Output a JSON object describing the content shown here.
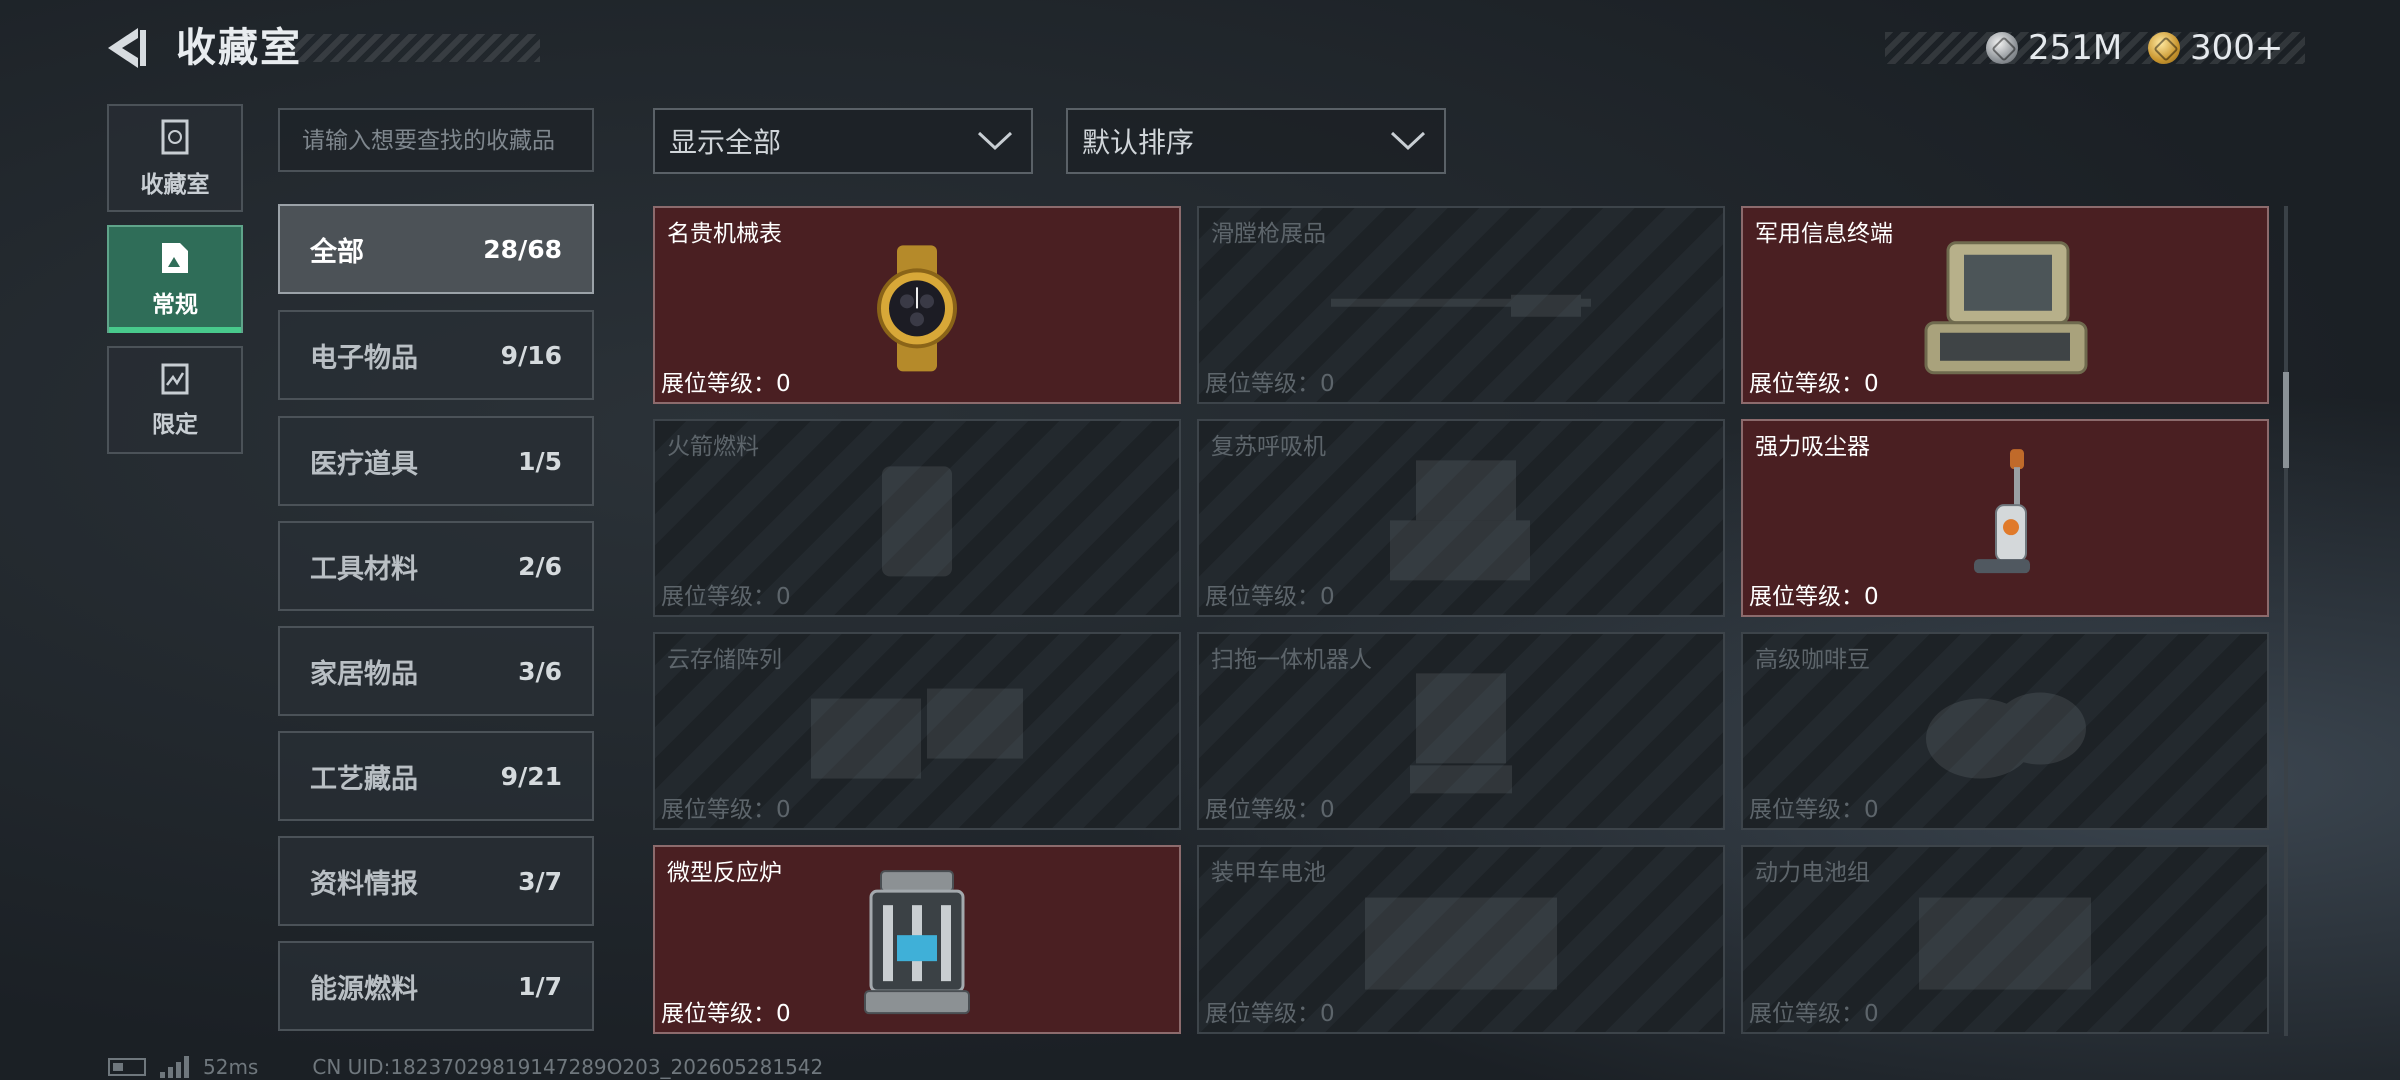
{
  "header": {
    "title": "收藏室"
  },
  "currency": {
    "silver": "251M",
    "gold": "300+"
  },
  "rail": [
    {
      "label": "收藏室",
      "icon": "collection-icon",
      "active": false
    },
    {
      "label": "常规",
      "icon": "regular-icon",
      "active": true
    },
    {
      "label": "限定",
      "icon": "limited-icon",
      "active": false
    }
  ],
  "search": {
    "placeholder": "请输入想要查找的收藏品"
  },
  "categories": [
    {
      "name": "全部",
      "count": "28/68",
      "active": true
    },
    {
      "name": "电子物品",
      "count": "9/16"
    },
    {
      "name": "医疗道具",
      "count": "1/5"
    },
    {
      "name": "工具材料",
      "count": "2/6"
    },
    {
      "name": "家居物品",
      "count": "3/6"
    },
    {
      "name": "工艺藏品",
      "count": "9/21"
    },
    {
      "name": "资料情报",
      "count": "3/7"
    },
    {
      "name": "能源燃料",
      "count": "1/7"
    }
  ],
  "filters": {
    "show": "显示全部",
    "sort": "默认排序"
  },
  "level_label": "展位等级：",
  "items": [
    {
      "name": "名贵机械表",
      "level": "0",
      "owned": true,
      "icon": "watch-icon"
    },
    {
      "name": "滑膛枪展品",
      "level": "0",
      "owned": false,
      "icon": "musket-icon"
    },
    {
      "name": "军用信息终端",
      "level": "0",
      "owned": true,
      "icon": "military-terminal-icon"
    },
    {
      "name": "火箭燃料",
      "level": "0",
      "owned": false,
      "icon": "rocket-fuel-icon"
    },
    {
      "name": "复苏呼吸机",
      "level": "0",
      "owned": false,
      "icon": "ventilator-icon"
    },
    {
      "name": "强力吸尘器",
      "level": "0",
      "owned": true,
      "icon": "vacuum-cleaner-icon"
    },
    {
      "name": "云存储阵列",
      "level": "0",
      "owned": false,
      "icon": "storage-array-icon"
    },
    {
      "name": "扫拖一体机器人",
      "level": "0",
      "owned": false,
      "icon": "robot-vacuum-icon"
    },
    {
      "name": "高级咖啡豆",
      "level": "0",
      "owned": false,
      "icon": "coffee-beans-icon"
    },
    {
      "name": "微型反应炉",
      "level": "0",
      "owned": true,
      "icon": "micro-reactor-icon"
    },
    {
      "name": "装甲车电池",
      "level": "0",
      "owned": false,
      "icon": "armored-battery-icon"
    },
    {
      "name": "动力电池组",
      "level": "0",
      "owned": false,
      "icon": "power-battery-icon"
    }
  ],
  "status": {
    "ping": "52ms",
    "uid": "CN UID:18237029819147289O203_202605281542"
  },
  "colors": {
    "owned_card": "#4a1f22",
    "active_tab": "#2f6d58",
    "active_underline": "#48c98c"
  }
}
